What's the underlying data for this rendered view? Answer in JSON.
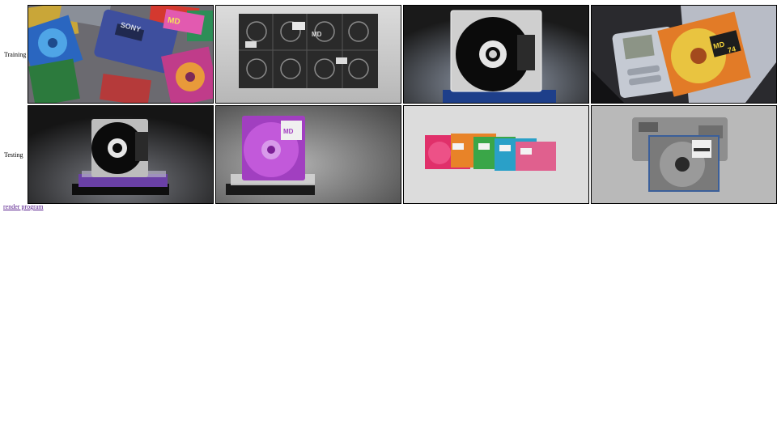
{
  "rows": [
    {
      "label": "Training"
    },
    {
      "label": "Testing"
    }
  ],
  "thumbnails": {
    "train_1": {
      "brand": "SONY",
      "badge": "MD"
    },
    "train_2": {
      "badge": "MD"
    },
    "train_4": {
      "badge": "MD",
      "badge_number": "74"
    },
    "test_2": {
      "badge": "MD"
    }
  },
  "link": {
    "label": "render program"
  }
}
